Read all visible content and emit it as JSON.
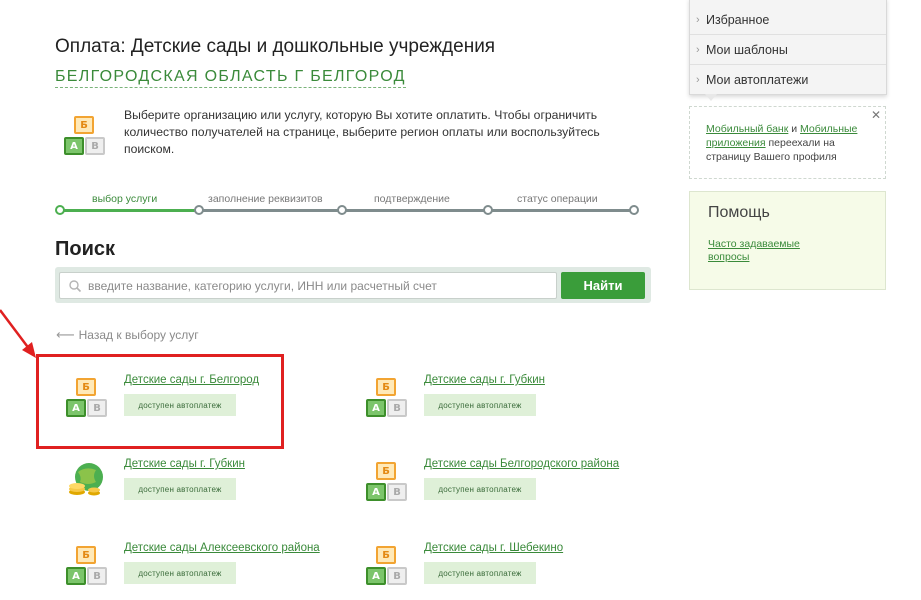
{
  "page": {
    "title": "Оплата: Детские сады и дошкольные учреждения",
    "region": "БЕЛГОРОДСКАЯ ОБЛАСТЬ Г БЕЛГОРОД",
    "intro": "Выберите организацию или услугу, которую Вы хотите оплатить. Чтобы ограничить количество получателей на странице, выберите регион оплаты или воспользуйтесь поиском."
  },
  "icon_letters": {
    "top": "Б",
    "left": "А",
    "right": "В"
  },
  "steps": [
    {
      "label": "выбор услуги",
      "state": "active"
    },
    {
      "label": "заполнение реквизитов",
      "state": "pending"
    },
    {
      "label": "подтверждение",
      "state": "pending"
    },
    {
      "label": "статус операции",
      "state": "pending"
    }
  ],
  "search": {
    "title": "Поиск",
    "placeholder": "введите название, категорию услуги, ИНН или расчетный счет",
    "button": "Найти"
  },
  "back_link": "Назад к выбору услуг",
  "organizations": [
    {
      "name": "Детские сады г. Белгород",
      "badge": "доступен автоплатеж",
      "icon": "abc-blocks-icon",
      "highlighted": true
    },
    {
      "name": "Детские сады г. Губкин",
      "badge": "доступен автоплатеж",
      "icon": "abc-blocks-icon"
    },
    {
      "name": "Детские сады г. Губкин",
      "badge": "доступен автоплатеж",
      "icon": "globe-coins-icon"
    },
    {
      "name": "Детские сады Белгородского района",
      "badge": "доступен автоплатеж",
      "icon": "abc-blocks-icon"
    },
    {
      "name": "Детские сады Алексеевского района",
      "badge": "доступен автоплатеж",
      "icon": "abc-blocks-icon"
    },
    {
      "name": "Детские сады г. Шебекино",
      "badge": "доступен автоплатеж",
      "icon": "abc-blocks-icon"
    }
  ],
  "sidebar": {
    "menu": [
      "Избранное",
      "Мои шаблоны",
      "Мои автоплатежи"
    ],
    "notice": {
      "link1": "Мобильный банк",
      "and": " и ",
      "link2": "Мобильные приложения",
      "rest": " переехали на страницу Вашего профиля"
    },
    "help": {
      "title": "Помощь",
      "faq": "Часто задаваемые вопросы"
    }
  },
  "colors": {
    "accent_green": "#3a9d3a",
    "link_green": "#3a8a3a",
    "highlight_red": "#e02020"
  }
}
